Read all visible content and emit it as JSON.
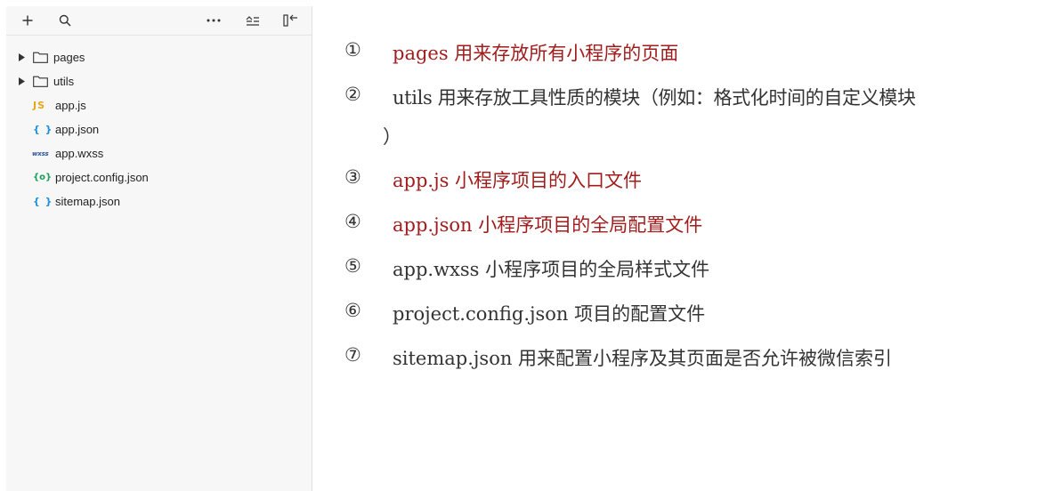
{
  "toolbar": {
    "icons": [
      "plus-icon",
      "search-icon",
      "more-icon",
      "collapse-icon",
      "panel-toggle-icon"
    ]
  },
  "tree": {
    "folders": [
      {
        "name": "pages"
      },
      {
        "name": "utils"
      }
    ],
    "files": [
      {
        "icon_text": "JS",
        "name": "app.js"
      },
      {
        "icon_text": "{ }",
        "name": "app.json"
      },
      {
        "icon_text": "wxss",
        "name": "app.wxss"
      },
      {
        "icon_text": "{o}",
        "name": "project.config.json"
      },
      {
        "icon_text": "{ }",
        "name": "sitemap.json"
      }
    ]
  },
  "notes": [
    {
      "num": "①",
      "text": "pages 用来存放所有小程序的页面",
      "color": "#a11d1d"
    },
    {
      "num": "②",
      "text": "utils 用来存放工具性质的模块（例如：格式化时间的自定义模块",
      "text_cont": "）",
      "color": "#333333"
    },
    {
      "num": "③",
      "text": "app.js 小程序项目的入口文件",
      "color": "#a11d1d"
    },
    {
      "num": "④",
      "text": "app.json 小程序项目的全局配置文件",
      "color": "#a11d1d"
    },
    {
      "num": "⑤",
      "text": "app.wxss 小程序项目的全局样式文件",
      "color": "#333333"
    },
    {
      "num": "⑥",
      "text": "project.config.json 项目的配置文件",
      "color": "#333333"
    },
    {
      "num": "⑦",
      "text": "sitemap.json 用来配置小程序及其页面是否允许被微信索引",
      "color": "#333333"
    }
  ]
}
